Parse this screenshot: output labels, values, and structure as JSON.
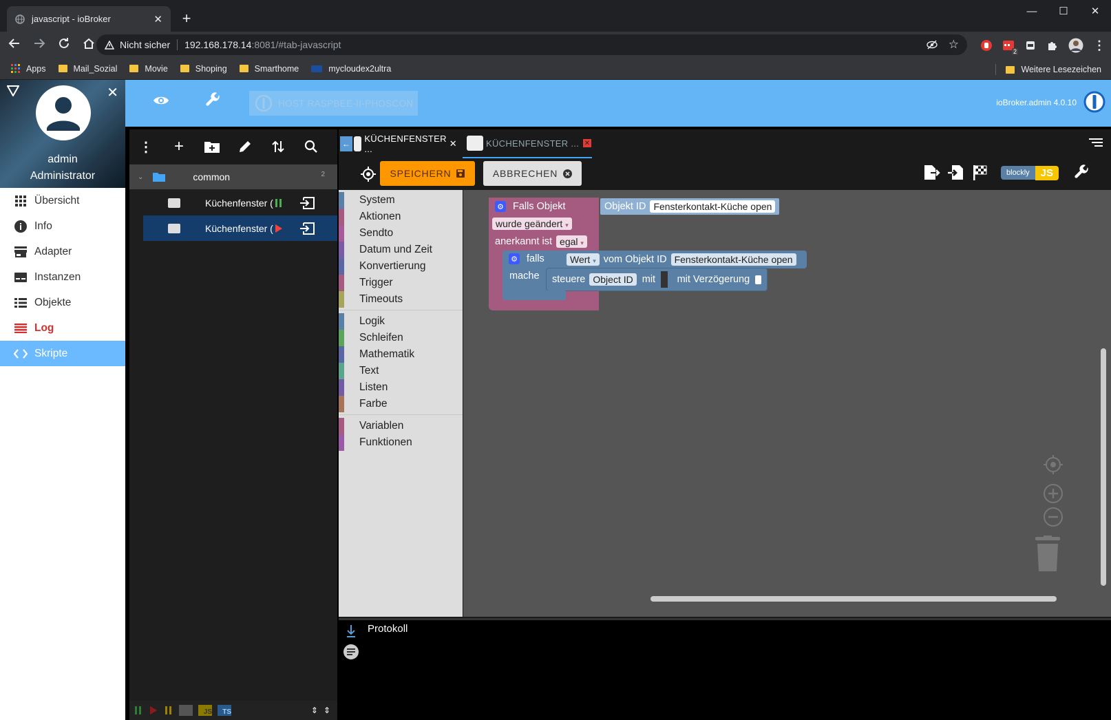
{
  "browser": {
    "tab_title": "javascript - ioBroker",
    "security_label": "Nicht sicher",
    "url_host": "192.168.178.14",
    "url_rest": ":8081/#tab-javascript",
    "bookmarks": [
      {
        "label": "Apps",
        "icon": "apps-grid-icon"
      },
      {
        "label": "Mail_Sozial",
        "icon": "folder-icon"
      },
      {
        "label": "Movie",
        "icon": "folder-icon"
      },
      {
        "label": "Shoping",
        "icon": "folder-icon"
      },
      {
        "label": "Smarthome",
        "icon": "folder-icon"
      },
      {
        "label": "mycloudex2ultra",
        "icon": "wd-icon"
      }
    ],
    "other_bookmarks": "Weitere Lesezeichen",
    "extension_badge": "2"
  },
  "profile": {
    "user": "admin",
    "role": "Administrator"
  },
  "nav": [
    {
      "label": "Übersicht",
      "icon": "grid-icon"
    },
    {
      "label": "Info",
      "icon": "info-icon"
    },
    {
      "label": "Adapter",
      "icon": "store-icon"
    },
    {
      "label": "Instanzen",
      "icon": "instances-icon"
    },
    {
      "label": "Objekte",
      "icon": "list-icon"
    },
    {
      "label": "Log",
      "icon": "log-icon"
    },
    {
      "label": "Skripte",
      "icon": "code-icon"
    }
  ],
  "topbar": {
    "host": "HOST RASPBEE-II-PHOSCON",
    "version": "ioBroker.admin 4.0.10"
  },
  "tree": {
    "folder": {
      "name": "common",
      "count": "2"
    },
    "scripts": [
      {
        "name": "Küchenfenster (",
        "state": "paused"
      },
      {
        "name": "Küchenfenster (",
        "state": "stopped"
      }
    ]
  },
  "editor": {
    "tabs": [
      {
        "label": "KÜCHENFENSTER ..."
      },
      {
        "label": "KÜCHENFENSTER ..."
      }
    ],
    "save_label": "SPEICHERN",
    "cancel_label": "ABBRECHEN",
    "blockly_label": "blockly",
    "js_label": "JS"
  },
  "toolbox": {
    "groups": [
      [
        {
          "label": "System",
          "color": "#5b80a5"
        },
        {
          "label": "Aktionen",
          "color": "#a55b80"
        },
        {
          "label": "Sendto",
          "color": "#a55b99"
        },
        {
          "label": "Datum und Zeit",
          "color": "#7a5ba5"
        },
        {
          "label": "Konvertierung",
          "color": "#5b67a5"
        },
        {
          "label": "Trigger",
          "color": "#a55b80"
        },
        {
          "label": "Timeouts",
          "color": "#a5a55b"
        }
      ],
      [
        {
          "label": "Logik",
          "color": "#5b80a5"
        },
        {
          "label": "Schleifen",
          "color": "#5ba55b"
        },
        {
          "label": "Mathematik",
          "color": "#5b67a5"
        },
        {
          "label": "Text",
          "color": "#5ba58c"
        },
        {
          "label": "Listen",
          "color": "#745ba5"
        },
        {
          "label": "Farbe",
          "color": "#a5745b"
        }
      ],
      [
        {
          "label": "Variablen",
          "color": "#a55b80"
        },
        {
          "label": "Funktionen",
          "color": "#995ba5"
        }
      ]
    ]
  },
  "blocks": {
    "trigger_title": "Falls Objekt",
    "object_id_label": "Objekt ID",
    "object_id_value": "Fensterkontakt-Küche open",
    "changed": "wurde geändert",
    "ack_label": "anerkannt ist",
    "ack_value": "egal",
    "if_label": "falls",
    "value_label": "Wert",
    "from_object": "vom Objekt ID",
    "value_object": "Fensterkontakt-Küche open",
    "do_label": "mache",
    "control_label": "steuere",
    "control_target": "Object ID",
    "with_label": "mit",
    "delay_label": "mit Verzögerung"
  },
  "log": {
    "title": "Protokoll"
  }
}
